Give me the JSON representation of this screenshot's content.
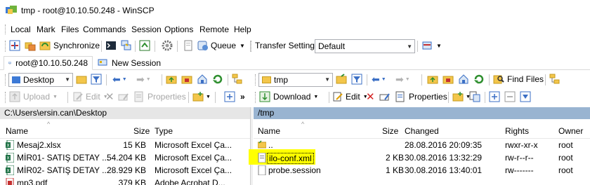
{
  "window": {
    "title": "tmp - root@10.10.50.248 - WinSCP"
  },
  "menu": [
    "Local",
    "Mark",
    "Files",
    "Commands",
    "Session",
    "Options",
    "Remote",
    "Help"
  ],
  "toolbar": {
    "synchronize_label": "Synchronize",
    "queue_label": "Queue",
    "transfer_settings_label": "Transfer Settings",
    "transfer_settings_value": "Default"
  },
  "tabs": [
    {
      "label": "root@10.10.50.248"
    },
    {
      "label": "New Session"
    }
  ],
  "local": {
    "drive": "Desktop",
    "upload_label": "Upload",
    "edit_label": "Edit",
    "properties_label": "Properties",
    "path": "C:\\Users\\ersin.can\\Desktop",
    "columns": {
      "name": "Name",
      "size": "Size",
      "type": "Type"
    },
    "files": [
      {
        "name": "Mesaj2.xlsx",
        "size": "15 KB",
        "type": "Microsoft Excel Ça..."
      },
      {
        "name": "MİR01- SATIŞ DETAY ...",
        "size": "54.204 KB",
        "type": "Microsoft Excel Ça..."
      },
      {
        "name": "MİR02- SATIŞ DETAY ...",
        "size": "28.929 KB",
        "type": "Microsoft Excel Ça..."
      },
      {
        "name": "mp3.pdf",
        "size": "379 KB",
        "type": "Adobe Acrobat D..."
      }
    ]
  },
  "remote": {
    "dir": "tmp",
    "find_files_label": "Find Files",
    "download_label": "Download",
    "edit_label": "Edit",
    "properties_label": "Properties",
    "path": "/tmp",
    "columns": {
      "name": "Name",
      "size": "Size",
      "changed": "Changed",
      "rights": "Rights",
      "owner": "Owner"
    },
    "files": [
      {
        "name": "..",
        "size": "",
        "changed": "28.08.2016 20:09:35",
        "rights": "rwxr-xr-x",
        "owner": "root"
      },
      {
        "name": "ilo-conf.xml",
        "size": "2 KB",
        "changed": "30.08.2016 13:32:29",
        "rights": "rw-r--r--",
        "owner": "root"
      },
      {
        "name": "probe.session",
        "size": "1 KB",
        "changed": "30.08.2016 13:40:01",
        "rights": "rw-------",
        "owner": "root"
      }
    ]
  },
  "colors": {
    "highlight": "#ffff00",
    "panel_path_bg": "#e6e6e6",
    "remote_path_bg": "#99b4d1"
  }
}
